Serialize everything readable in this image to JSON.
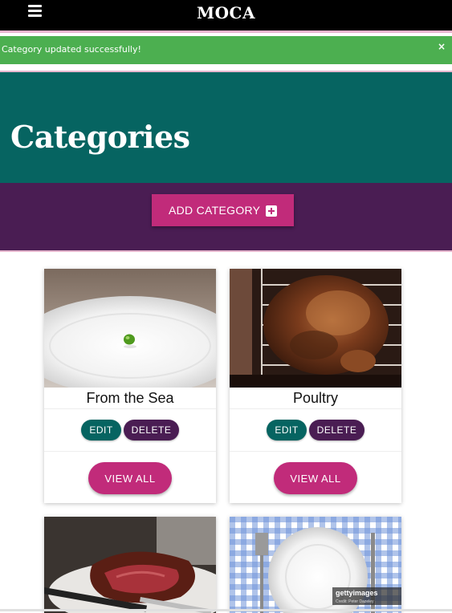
{
  "nav": {
    "brand": "MOCA",
    "menu_icon": "hamburger-icon"
  },
  "alert": {
    "message": "Category updated successfully!",
    "close": "×"
  },
  "hero": {
    "title": "Categories"
  },
  "actions": {
    "add_label": "ADD CATEGORY",
    "add_icon": "plus-square-icon"
  },
  "categories": [
    {
      "name": "From the Sea",
      "edit": "EDIT",
      "delete": "DELETE",
      "view": "VIEW ALL"
    },
    {
      "name": "Poultry",
      "edit": "EDIT",
      "delete": "DELETE",
      "view": "VIEW ALL"
    },
    {
      "name": "",
      "edit": "",
      "delete": "",
      "view": ""
    },
    {
      "name": "",
      "edit": "",
      "delete": "",
      "view": ""
    }
  ],
  "watermark": {
    "brand": "gettyimages",
    "credit": "Credit: Peter Dazeley"
  },
  "colors": {
    "nav_bg": "#000000",
    "success": "#4caf50",
    "teal": "#066461",
    "purple": "#4a1d53",
    "magenta": "#c12b7a"
  }
}
